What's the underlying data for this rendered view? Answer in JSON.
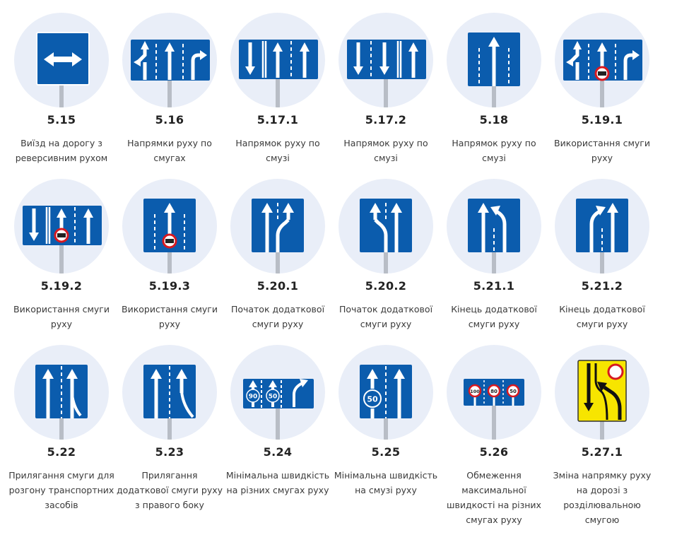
{
  "colors": {
    "sign_blue": "#0b5cad",
    "sign_yellow": "#f7e500",
    "circle_bg": "#e9eef8",
    "pole": "#b8bdc6",
    "speed_red": "#d71920"
  },
  "signs": [
    {
      "code": "5.15",
      "desc": "Виїзд на дорогу з реверсивним рухом",
      "icon": "reversible-road-sign-icon"
    },
    {
      "code": "5.16",
      "desc": "Напрямки руху по смугах",
      "icon": "lane-directions-sign-icon"
    },
    {
      "code": "5.17.1",
      "desc": "Напрямок руху по смузі",
      "icon": "lane-direction-sign-icon"
    },
    {
      "code": "5.17.2",
      "desc": "Напрямок руху по смузі",
      "icon": "lane-direction-sign-icon"
    },
    {
      "code": "5.18",
      "desc": "Напрямок руху по смузі",
      "icon": "lane-direction-sign-icon"
    },
    {
      "code": "5.19.1",
      "desc": "Використання смуги руху",
      "icon": "lane-use-sign-icon"
    },
    {
      "code": "5.19.2",
      "desc": "Використання смуги руху",
      "icon": "lane-use-sign-icon"
    },
    {
      "code": "5.19.3",
      "desc": "Використання смуги руху",
      "icon": "lane-use-sign-icon"
    },
    {
      "code": "5.20.1",
      "desc": "Початок додаткової смуги руху",
      "icon": "additional-lane-start-sign-icon"
    },
    {
      "code": "5.20.2",
      "desc": "Початок додаткової смуги руху",
      "icon": "additional-lane-start-sign-icon"
    },
    {
      "code": "5.21.1",
      "desc": "Кінець додаткової смуги руху",
      "icon": "additional-lane-end-sign-icon"
    },
    {
      "code": "5.21.2",
      "desc": "Кінець додаткової смуги руху",
      "icon": "additional-lane-end-sign-icon"
    },
    {
      "code": "5.22",
      "desc": "Прилягання смуги для розгону транспортних засобів",
      "icon": "acceleration-lane-sign-icon"
    },
    {
      "code": "5.23",
      "desc": "Прилягання додаткової смуги руху з правого боку",
      "icon": "right-lane-join-sign-icon"
    },
    {
      "code": "5.24",
      "desc": "Мінімальна швидкість на різних смугах руху",
      "icon": "minimum-speed-lanes-sign-icon",
      "speeds": [
        "90",
        "50"
      ]
    },
    {
      "code": "5.25",
      "desc": "Мінімальна швидкість на смузі руху",
      "icon": "minimum-speed-lane-sign-icon",
      "speeds": [
        "50"
      ]
    },
    {
      "code": "5.26",
      "desc": "Обмеження максимальної швидкості на різних смугах руху",
      "icon": "max-speed-lanes-sign-icon",
      "speeds": [
        "100",
        "80",
        "50"
      ]
    },
    {
      "code": "5.27.1",
      "desc": "Зміна напрямку руху на дорозі з розділювальною смугою",
      "icon": "direction-change-sign-icon"
    }
  ]
}
